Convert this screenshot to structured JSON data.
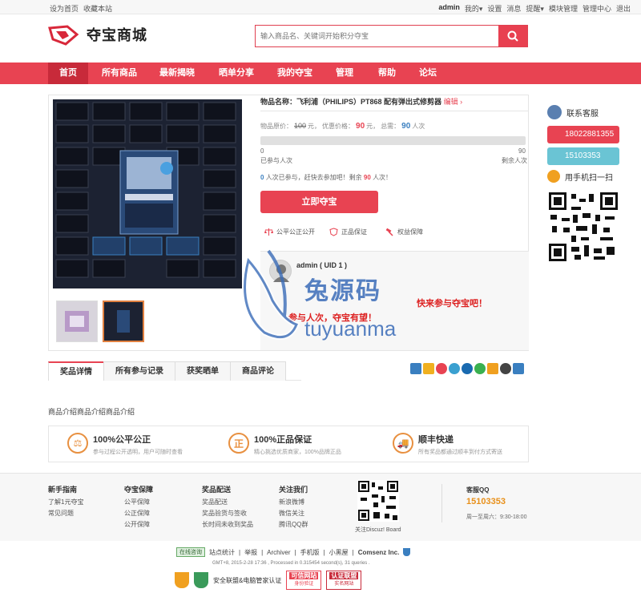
{
  "topbar": {
    "left": [
      "设为首页",
      "收藏本站"
    ],
    "user": "admin",
    "right": [
      "我的",
      "设置",
      "消息",
      "提醒",
      "模块管理",
      "管理中心",
      "退出"
    ]
  },
  "logo": {
    "text": "夺宝商城"
  },
  "search": {
    "placeholder": "输入商品名、关键词开始积分夺宝"
  },
  "nav": [
    "首页",
    "所有商品",
    "最新揭晓",
    "晒单分享",
    "我的夺宝",
    "管理",
    "帮助",
    "论坛"
  ],
  "product": {
    "name_label": "物品名称：",
    "name": "飞利浦（PHILIPS）PT868 配有弹出式修剪器",
    "edit": "编辑",
    "orig_label": "物品原价：",
    "orig_price": "100",
    "unit": "元，",
    "promo_label": "优惠价格：",
    "promo_price": "90",
    "unit2": "元，",
    "total_label": "总需：",
    "total": "90",
    "total_unit": "人次",
    "progress": 0,
    "bar_left": "0",
    "bar_right": "90",
    "joined_label": "已参与人次",
    "remain_label": "剩余人次",
    "join_count": "0",
    "join_text": "人次已参与，赶快去参加吧！剩余",
    "remain": "90",
    "remain_unit": "人次！",
    "buy": "立即夺宝",
    "guarantees": [
      "公平公正公开",
      "正品保证",
      "权益保障"
    ]
  },
  "review": {
    "user": "admin ( UID 1 )",
    "text1": "快来参与夺宝吧！",
    "text2": "参与人次，夺宝有望！"
  },
  "watermark": {
    "cn": "兔源码",
    "en": "tuyuanma"
  },
  "side": {
    "title": "联系客服",
    "phone": "18022881355",
    "qq": "15103353",
    "scan": "用手机扫一扫"
  },
  "tabs": [
    "奖品详情",
    "所有参与记录",
    "获奖晒单",
    "商品评论"
  ],
  "desc": "商品介绍商品介绍商品介绍",
  "features": [
    {
      "title": "100%公平公正",
      "sub": "参与过程公开透明，用户可随时查看"
    },
    {
      "title": "100%正品保证",
      "sub": "精心挑选优质商家，100%品牌正品"
    },
    {
      "title": "顺丰快递",
      "sub": "所有奖品都通过顺丰到付方式寄送"
    }
  ],
  "footer": {
    "cols": [
      {
        "title": "新手指南",
        "items": [
          "了解1元夺宝",
          "常见问题"
        ]
      },
      {
        "title": "夺宝保障",
        "items": [
          "公平保障",
          "公正保障",
          "公开保障"
        ]
      },
      {
        "title": "奖品配送",
        "items": [
          "奖品配送",
          "奖品验货与签收",
          "长时间未收到奖品"
        ]
      },
      {
        "title": "关注我们",
        "items": [
          "新浪微博",
          "微信关注",
          "腾讯QQ群"
        ]
      }
    ],
    "qr_label": "关注Discuz! Board",
    "qq_title": "客服QQ",
    "qq": "15103353",
    "hours": "周一至周六：9:30-18:00"
  },
  "bottom": {
    "online": "在线咨询",
    "links": [
      "站点统计",
      "举报",
      "Archiver",
      "手机版",
      "小黑屋",
      "Comsenz Inc."
    ],
    "gmt": "GMT+8, 2015-2-28 17:36 , Processed in 0.315454 second(s), 31 queries .",
    "cert": "安全联盟&电脑管家认证",
    "badge1": "可信网站",
    "badge1s": "身份验证",
    "badge2": "认证联盟",
    "badge2s": "实名网站"
  }
}
